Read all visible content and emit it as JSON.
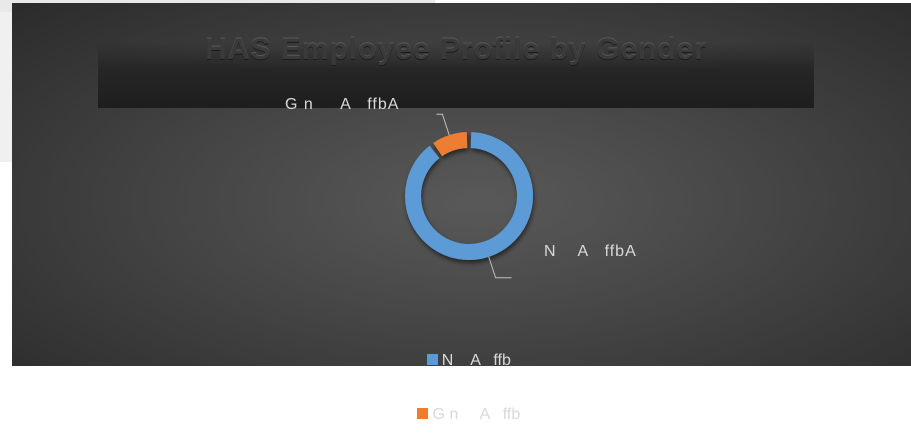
{
  "chart_data": {
    "type": "pie",
    "subtype": "doughnut",
    "title": "HAS Employee Profile by Gender",
    "slices": [
      {
        "label": "N    A   ffb",
        "data_label": "N    A   ffbA",
        "value": 0.9,
        "color": "#5b9bd5"
      },
      {
        "label": "G n     A   ffb",
        "data_label": "G n     A   ffbA",
        "value": 0.1,
        "color": "#ed7d31"
      }
    ],
    "legend": "bottom"
  }
}
